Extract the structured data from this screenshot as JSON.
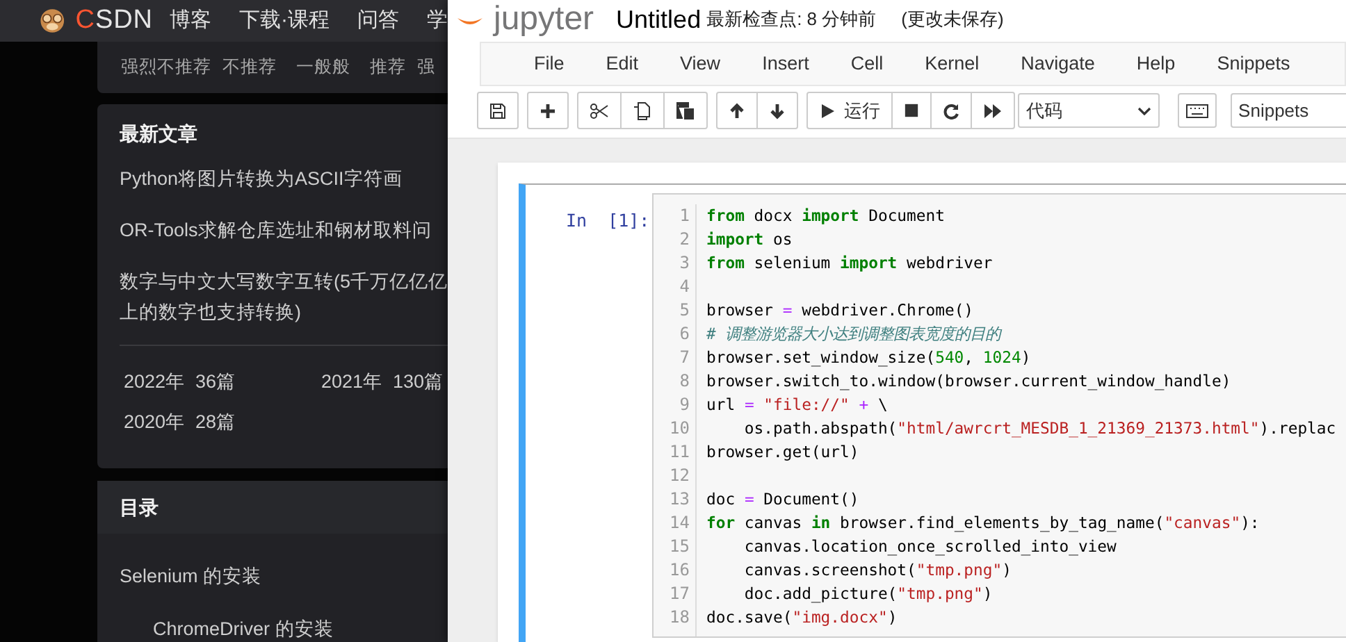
{
  "csdn": {
    "logo_text": "CSDN",
    "nav": [
      "博客",
      "下载·课程",
      "问答",
      "学"
    ],
    "ratings": [
      "强烈不推荐",
      "不推荐",
      "一般般",
      "推荐",
      "强"
    ],
    "latest": {
      "title": "最新文章",
      "articles": [
        {
          "lines": [
            "Python将图片转换为ASCII字符画"
          ]
        },
        {
          "lines": [
            "OR-Tools求解仓库选址和钢材取料问"
          ]
        },
        {
          "lines": [
            "数字与中文大写数字互转(5千万亿亿亿",
            "上的数字也支持转换)"
          ]
        }
      ],
      "archive": [
        {
          "year": "2022年",
          "count": "36篇"
        },
        {
          "year": "2021年",
          "count": "130篇"
        },
        {
          "year": "2020年",
          "count": "28篇"
        }
      ]
    },
    "toc": {
      "title": "目录",
      "items": [
        {
          "label": "Selenium 的安装",
          "children": [
            {
              "label": "ChromeDriver 的安装"
            }
          ]
        }
      ]
    }
  },
  "jupyter": {
    "logo_text": "jupyter",
    "notebook_name": "Untitled",
    "checkpoint": "最新检查点: 8 分钟前",
    "save_status": "(更改未保存)",
    "menu": [
      "File",
      "Edit",
      "View",
      "Insert",
      "Cell",
      "Kernel",
      "Navigate",
      "Help",
      "Snippets"
    ],
    "toolbar": [
      [
        {
          "kind": "save"
        }
      ],
      [
        {
          "kind": "insert"
        }
      ],
      [
        {
          "kind": "cut"
        },
        {
          "kind": "copy"
        },
        {
          "kind": "paste"
        }
      ],
      [
        {
          "kind": "up"
        },
        {
          "kind": "down"
        }
      ],
      [
        {
          "kind": "run",
          "label": "运行"
        },
        {
          "kind": "stop"
        },
        {
          "kind": "restart"
        },
        {
          "kind": "run-all"
        }
      ]
    ],
    "cell_type": "代码",
    "snippets": "Snippets",
    "cell": {
      "prompt": "In  [1]:",
      "lines": [
        {
          "number": "1",
          "tokens": [
            {
              "kind": "keyword",
              "text": "from"
            },
            {
              "kind": "plain",
              "text": " docx "
            },
            {
              "kind": "keyword",
              "text": "import"
            },
            {
              "kind": "plain",
              "text": " Document"
            }
          ]
        },
        {
          "number": "2",
          "tokens": [
            {
              "kind": "keyword",
              "text": "import"
            },
            {
              "kind": "plain",
              "text": " os"
            }
          ]
        },
        {
          "number": "3",
          "tokens": [
            {
              "kind": "keyword",
              "text": "from"
            },
            {
              "kind": "plain",
              "text": " selenium "
            },
            {
              "kind": "keyword",
              "text": "import"
            },
            {
              "kind": "plain",
              "text": " webdriver"
            }
          ]
        },
        {
          "number": "4"
        },
        {
          "number": "5",
          "tokens": [
            {
              "kind": "plain",
              "text": "browser "
            },
            {
              "kind": "operator",
              "text": "="
            },
            {
              "kind": "plain",
              "text": " webdriver.Chrome()"
            }
          ]
        },
        {
          "number": "6",
          "tokens": [
            {
              "kind": "comment",
              "text": "# 调整游览器大小达到调整图表宽度的目的"
            }
          ]
        },
        {
          "number": "7",
          "tokens": [
            {
              "kind": "plain",
              "text": "browser.set_window_size("
            },
            {
              "kind": "number",
              "text": "540"
            },
            {
              "kind": "plain",
              "text": ", "
            },
            {
              "kind": "number",
              "text": "1024"
            },
            {
              "kind": "plain",
              "text": ")"
            }
          ]
        },
        {
          "number": "8",
          "tokens": [
            {
              "kind": "plain",
              "text": "browser.switch_to.window(browser.current_window_handle)"
            }
          ]
        },
        {
          "number": "9",
          "tokens": [
            {
              "kind": "plain",
              "text": "url "
            },
            {
              "kind": "operator",
              "text": "="
            },
            {
              "kind": "string",
              "text": " \"file://\""
            },
            {
              "kind": "operator",
              "text": " +"
            },
            {
              "kind": "plain",
              "text": " \\"
            }
          ]
        },
        {
          "number": "10",
          "tokens": [
            {
              "kind": "plain",
              "text": "    os.path.abspath("
            },
            {
              "kind": "string",
              "text": "\"html/awrcrt_MESDB_1_21369_21373.html\""
            },
            {
              "kind": "plain",
              "text": ").replac"
            }
          ]
        },
        {
          "number": "11",
          "tokens": [
            {
              "kind": "plain",
              "text": "browser.get(url)"
            }
          ]
        },
        {
          "number": "12"
        },
        {
          "number": "13",
          "tokens": [
            {
              "kind": "plain",
              "text": "doc "
            },
            {
              "kind": "operator",
              "text": "="
            },
            {
              "kind": "plain",
              "text": " Document()"
            }
          ]
        },
        {
          "number": "14",
          "tokens": [
            {
              "kind": "keyword",
              "text": "for"
            },
            {
              "kind": "plain",
              "text": " canvas "
            },
            {
              "kind": "keyword",
              "text": "in"
            },
            {
              "kind": "plain",
              "text": " browser.find_elements_by_tag_name("
            },
            {
              "kind": "string",
              "text": "\"canvas\""
            },
            {
              "kind": "plain",
              "text": "):"
            }
          ]
        },
        {
          "number": "15",
          "tokens": [
            {
              "kind": "plain",
              "text": "    canvas.location_once_scrolled_into_view"
            }
          ]
        },
        {
          "number": "16",
          "tokens": [
            {
              "kind": "plain",
              "text": "    canvas.screenshot("
            },
            {
              "kind": "string",
              "text": "\"tmp.png\""
            },
            {
              "kind": "plain",
              "text": ")"
            }
          ]
        },
        {
          "number": "17",
          "tokens": [
            {
              "kind": "plain",
              "text": "    doc.add_picture("
            },
            {
              "kind": "string",
              "text": "\"tmp.png\""
            },
            {
              "kind": "plain",
              "text": ")"
            }
          ]
        },
        {
          "number": "18",
          "tokens": [
            {
              "kind": "plain",
              "text": "doc.save("
            },
            {
              "kind": "string",
              "text": "\"img.docx\""
            },
            {
              "kind": "plain",
              "text": ")"
            }
          ]
        }
      ]
    }
  }
}
